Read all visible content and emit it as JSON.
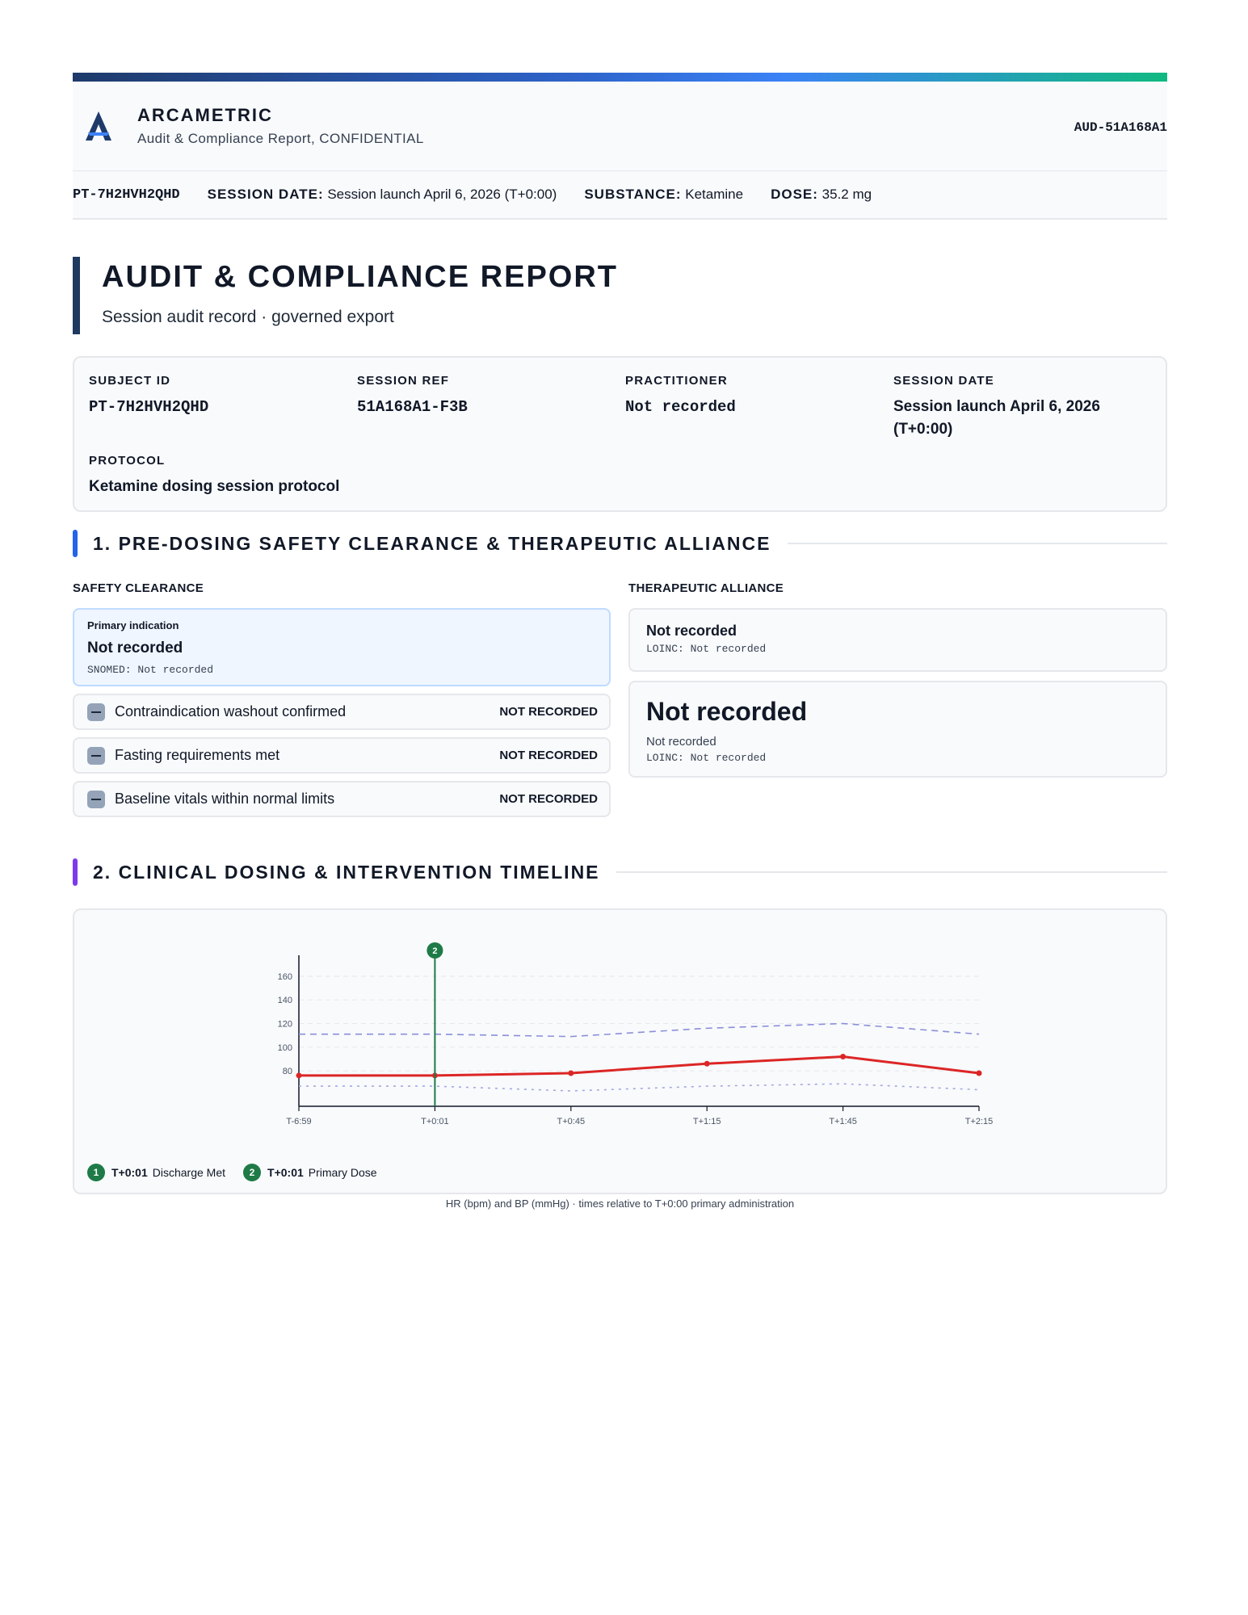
{
  "header": {
    "brand": "ARCAMETRIC",
    "subtitle": "Audit & Compliance Report, CONFIDENTIAL",
    "audit_id": "AUD-51A168A1",
    "logo_icon": "arcametric-logo-icon"
  },
  "meta_strip": {
    "patient_id": "PT-7H2HVH2QHD",
    "session_date_label": "SESSION DATE:",
    "session_date": "Session launch April 6, 2026 (T+0:00)",
    "substance_label": "SUBSTANCE:",
    "substance": "Ketamine",
    "dose_label": "DOSE:",
    "dose": "35.2 mg"
  },
  "title": {
    "main": "AUDIT & COMPLIANCE REPORT",
    "sub": "Session audit record · governed export"
  },
  "info": {
    "subject_id_label": "SUBJECT ID",
    "subject_id": "PT-7H2HVH2QHD",
    "session_ref_label": "SESSION REF",
    "session_ref": "51A168A1-F3B",
    "practitioner_label": "PRACTITIONER",
    "practitioner": "Not recorded",
    "session_date_label": "SESSION DATE",
    "session_date": "Session launch April 6, 2026 (T+0:00)",
    "protocol_label": "PROTOCOL",
    "protocol": "Ketamine dosing session protocol"
  },
  "section1": {
    "title": "1. PRE-DOSING SAFETY CLEARANCE & THERAPEUTIC ALLIANCE",
    "accent": "#2563eb",
    "safety_label": "SAFETY CLEARANCE",
    "alliance_label": "THERAPEUTIC ALLIANCE",
    "indication": {
      "label": "Primary indication",
      "value": "Not recorded",
      "code": "SNOMED: Not recorded"
    },
    "checks": [
      {
        "label": "Contraindication washout confirmed",
        "status": "NOT RECORDED"
      },
      {
        "label": "Fasting requirements met",
        "status": "NOT RECORDED"
      },
      {
        "label": "Baseline vitals within normal limits",
        "status": "NOT RECORDED"
      }
    ],
    "alliance_a": {
      "value": "Not recorded",
      "code": "LOINC: Not recorded"
    },
    "alliance_b": {
      "big": "Not recorded",
      "small": "Not recorded",
      "code": "LOINC: Not recorded"
    }
  },
  "section2": {
    "title": "2. CLINICAL DOSING & INTERVENTION TIMELINE",
    "accent": "#7c3aed",
    "caption": "HR (bpm) and BP (mmHg) · times relative to T+0:00 primary administration",
    "legend": [
      {
        "num": "1",
        "time": "T+0:01",
        "label": "Discharge Met"
      },
      {
        "num": "2",
        "time": "T+0:01",
        "label": "Primary Dose"
      }
    ]
  },
  "chart_data": {
    "type": "line",
    "x": [
      "T-6:59",
      "T+0:01",
      "T+0:45",
      "T+1:15",
      "T+1:45",
      "T+2:15"
    ],
    "y_ticks": [
      80,
      100,
      120,
      140,
      160
    ],
    "ylim": [
      50,
      175
    ],
    "series": [
      {
        "values": [
          76,
          76,
          78,
          86,
          92,
          78
        ],
        "color": "#dc2626",
        "style": "solid"
      },
      {
        "values": [
          111,
          111,
          109,
          116,
          120,
          111
        ],
        "color": "#8b8fd9",
        "style": "dashed"
      },
      {
        "values": [
          67,
          67,
          63,
          67,
          69,
          64
        ],
        "color": "#a5a8e0",
        "style": "dotted"
      }
    ],
    "event_marker": {
      "x": "T+0:01",
      "label": "2",
      "color": "#1e7a46"
    },
    "grid": true
  }
}
